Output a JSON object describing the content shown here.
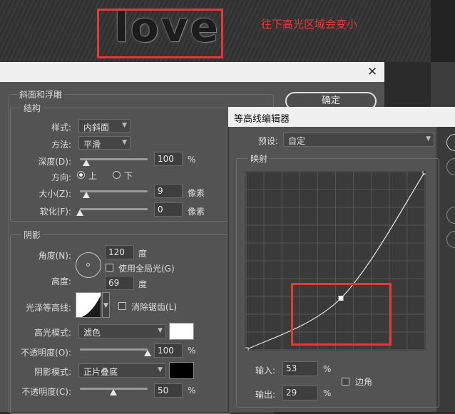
{
  "canvas": {
    "artwork_text": "love",
    "annotation": "往下高光区域会变小",
    "accent_color": "#e53935"
  },
  "layer_style": {
    "section_title": "斜面和浮雕",
    "ok_label": "确定",
    "structure": {
      "title": "结构",
      "style_label": "样式:",
      "style_value": "内斜面",
      "technique_label": "方法:",
      "technique_value": "平滑",
      "depth_label": "深度(D):",
      "depth_value": "100",
      "depth_unit": "%",
      "depth_level": 0.1,
      "direction_label": "方向:",
      "direction_up": "上",
      "direction_down": "下",
      "size_label": "大小(Z):",
      "size_value": "9",
      "size_unit": "像素",
      "soften_label": "软化(F):",
      "soften_value": "0",
      "soften_unit": "像素"
    },
    "shading": {
      "title": "阴影",
      "angle_label": "角度(N):",
      "angle_value": "120",
      "angle_unit": "度",
      "global_light_label": "使用全局光(G)",
      "altitude_label": "高度:",
      "altitude_value": "69",
      "altitude_unit": "度",
      "gloss_contour_label": "光泽等高线:",
      "anti_aliased_label": "消除锯齿(L)",
      "highlight_mode_label": "高光模式:",
      "highlight_mode_value": "滤色",
      "highlight_color": "#ffffff",
      "highlight_opacity_label": "不透明度(O):",
      "highlight_opacity_value": "100",
      "highlight_opacity_unit": "%",
      "shadow_mode_label": "阴影模式:",
      "shadow_mode_value": "正片叠底",
      "shadow_color": "#000000",
      "shadow_opacity_label": "不透明度(C):",
      "shadow_opacity_value": "50",
      "shadow_opacity_unit": "%"
    }
  },
  "contour_editor": {
    "title": "等高线编辑器",
    "preset_label": "预设:",
    "preset_value": "自定",
    "mapping_label": "映射",
    "input_label": "输入:",
    "input_value": "53",
    "input_unit": "%",
    "output_label": "输出:",
    "output_value": "29",
    "output_unit": "%",
    "corner_label": "边角",
    "curve_points": [
      {
        "input": 0,
        "output": 0
      },
      {
        "input": 53,
        "output": 29
      },
      {
        "input": 100,
        "output": 100
      }
    ]
  },
  "icons": {
    "close": "close-icon",
    "dropdown": "chevron-down-icon",
    "angle_dial": "angle-dial-icon"
  }
}
